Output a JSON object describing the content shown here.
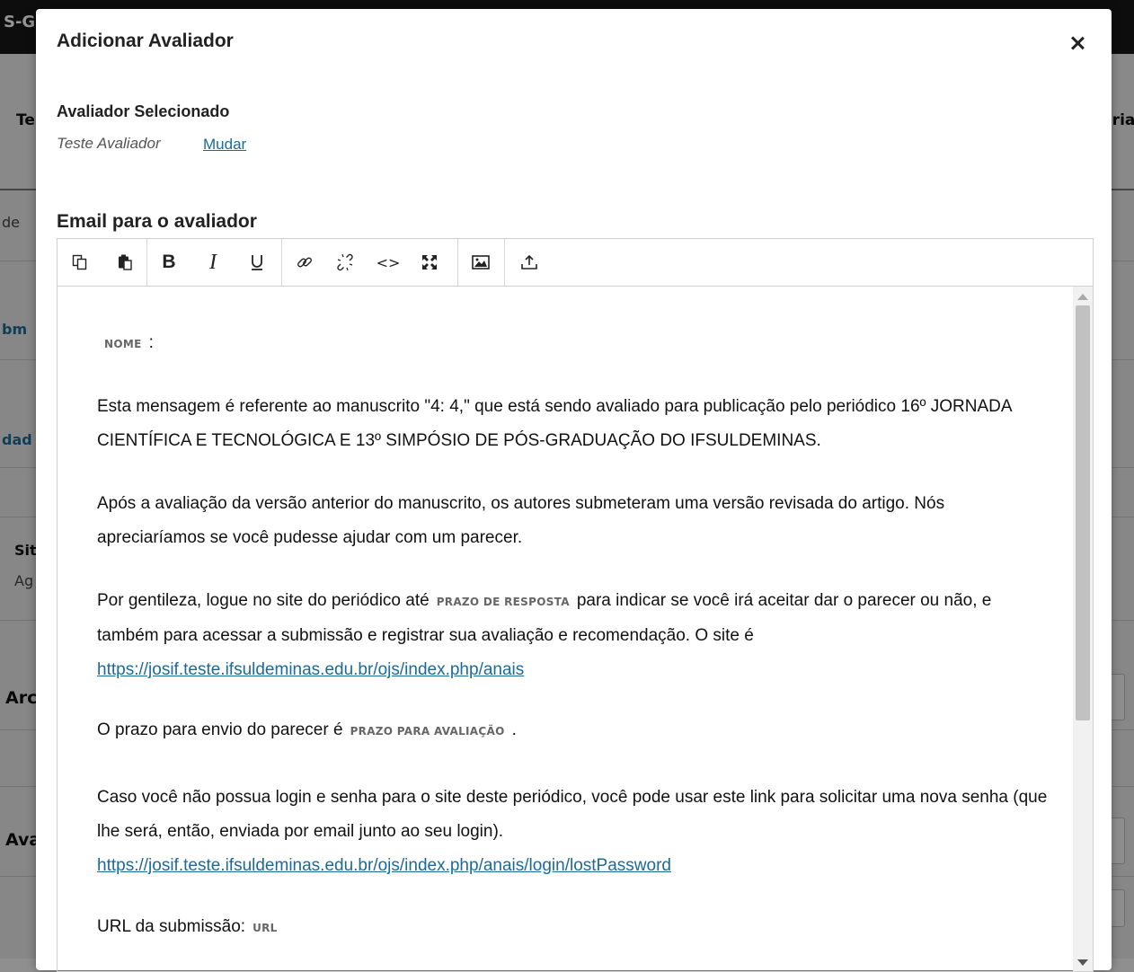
{
  "background": {
    "logo_fragment": "S-G",
    "tab_left": "Te",
    "tab_right": "ória",
    "fragments": [
      "de",
      "bm",
      "dad",
      "Sit",
      "Ag",
      "Arc",
      "Ava"
    ]
  },
  "modal": {
    "title": "Adicionar Avaliador",
    "close_label": "×",
    "selected_reviewer": {
      "label": "Avaliador Selecionado",
      "name": "Teste Avaliador",
      "change_link": "Mudar"
    },
    "email": {
      "label": "Email para o avaliador",
      "toolbar": [
        {
          "name": "copy-icon"
        },
        {
          "name": "paste-icon"
        },
        {
          "name": "bold-icon"
        },
        {
          "name": "italic-icon"
        },
        {
          "name": "underline-icon"
        },
        {
          "name": "link-icon"
        },
        {
          "name": "unlink-icon"
        },
        {
          "name": "code-icon"
        },
        {
          "name": "fullscreen-icon"
        },
        {
          "name": "image-icon"
        },
        {
          "name": "upload-icon"
        }
      ],
      "body": {
        "var_name": "NOME",
        "colon": ":",
        "p1": "Esta mensagem é referente ao manuscrito \"4: 4,\" que está sendo avaliado para publicação pelo periódico 16º JORNADA CIENTÍFICA E TECNOLÓGICA E 13º SIMPÓSIO DE PÓS-GRADUAÇÃO DO IFSULDEMINAS.",
        "p2": "Após a avaliação da versão anterior do manuscrito, os autores submeteram uma versão revisada do artigo. Nós apreciaríamos se você pudesse ajudar com um parecer.",
        "p3_a": "Por gentileza, logue no site do periódico até",
        "var_response_due": "PRAZO DE RESPOSTA",
        "p3_b": "para indicar se você irá aceitar dar o parecer ou não, e também para acessar a submissão e registrar sua avaliação e recomendação. O site é",
        "link_journal": "https://josif.teste.ifsuldeminas.edu.br/ojs/index.php/anais",
        "p4_a": "O prazo para envio do parecer é",
        "var_review_due": "PRAZO PARA AVALIAÇÃO",
        "p4_b": ".",
        "p5": "Caso você não possua login e senha para o site deste periódico, você pode usar este link para solicitar uma nova senha (que lhe será, então, enviada por email junto ao seu login).",
        "link_lost_password": "https://josif.teste.ifsuldeminas.edu.br/ojs/index.php/anais/login/lostPassword",
        "p6_a": "URL da submissão:",
        "var_url": "URL"
      }
    }
  }
}
